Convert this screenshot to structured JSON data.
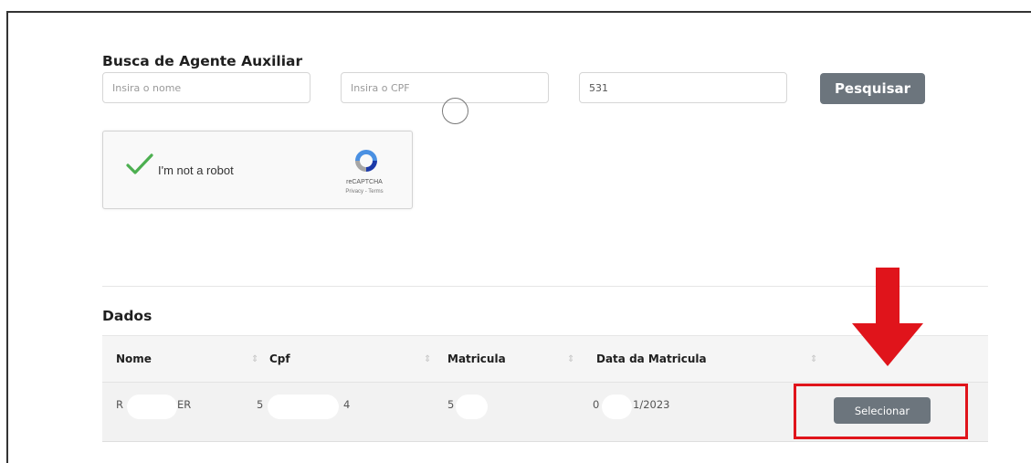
{
  "search": {
    "title": "Busca de Agente Auxiliar",
    "name_placeholder": "Insira o nome",
    "cpf_placeholder": "Insira o CPF",
    "matricula_value": "531",
    "button_label": "Pesquisar"
  },
  "captcha": {
    "label": "I'm not a robot",
    "brand": "reCAPTCHA",
    "links": "Privacy - Terms"
  },
  "dados": {
    "title": "Dados",
    "columns": [
      "Nome",
      "Cpf",
      "Matricula",
      "Data da Matricula"
    ],
    "row": {
      "nome_start": "R",
      "nome_end": "ER",
      "cpf_start": "5",
      "cpf_end": "4",
      "matricula": "5",
      "data_start": "0",
      "data_end": "1/2023",
      "action_label": "Selecionar"
    }
  },
  "colors": {
    "button_gray": "#6c757d",
    "annotation_red": "#e0141b",
    "check_green": "#4caf50"
  },
  "icons": [
    "checkmark-icon",
    "recaptcha-logo-icon",
    "sort-icon",
    "red-arrow-down"
  ]
}
